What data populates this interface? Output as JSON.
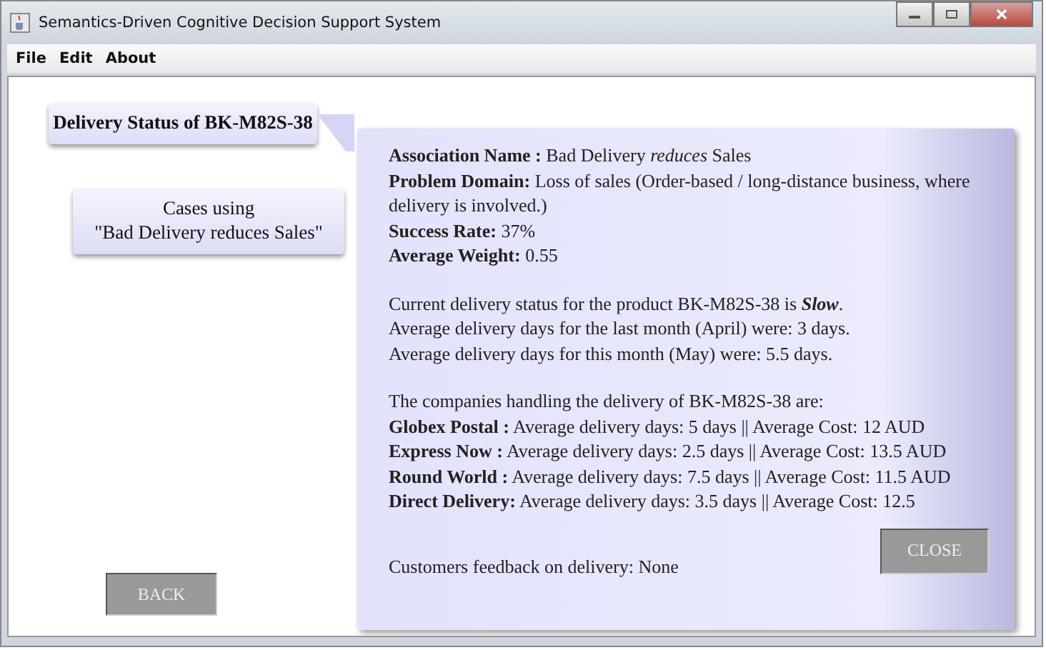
{
  "window": {
    "title": "Semantics-Driven Cognitive Decision Support System"
  },
  "menu": [
    "File",
    "Edit",
    "About"
  ],
  "nav": [
    {
      "label": "Delivery  Status of BK-M82S-38",
      "selected": true
    },
    {
      "label": "Cases using\n\"Bad Delivery reduces Sales\"",
      "selected": false
    }
  ],
  "back_button": "BACK",
  "details": {
    "summary": [
      "**Association Name :** Bad Delivery *reduces* Sales",
      "**Problem Domain:** Loss of sales (Order-based / long-distance business, where delivery is involved.)",
      "**Success Rate:** 37%",
      "**Average Weight:** 0.55"
    ],
    "status": [
      "Current delivery status for the product BK-M82S-38 is *Slow*.",
      "Average delivery days for the last month (April) were: 3 days.",
      "Average delivery days for this month (May) were:  5.5 days."
    ],
    "companies": [
      "The companies handling the delivery of BK-M82S-38 are:",
      "**Globex Postal   :**  Average delivery days: 5 days  || Average Cost:  12 AUD",
      "**Express Now :** Average delivery days: 2.5 days  || Average Cost:  13.5 AUD",
      "**Round World :** Average delivery days: 7.5 days ||  Average Cost:  11.5 AUD",
      "**Direct Delivery:** Average delivery days: 3.5 days ||  Average Cost: 12.5"
    ],
    "feedback": "Customers feedback on delivery: None",
    "close_button": "CLOSE"
  }
}
